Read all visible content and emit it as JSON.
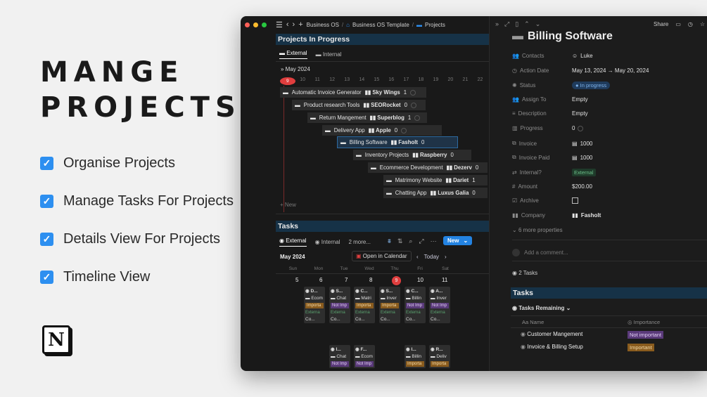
{
  "hero": {
    "line1": "MANGE",
    "line2": "PROJECTS"
  },
  "features": [
    "Organise Projects",
    "Manage Tasks For Projects",
    "Details View For Projects",
    "Timeline View"
  ],
  "logo": "N",
  "topbar": {
    "crumb1": "Business OS",
    "crumb2": "Business OS Template",
    "crumb3": "Projects",
    "share": "Share"
  },
  "projects": {
    "title": "Projects In Progress",
    "tabs": [
      "External",
      "Internal"
    ],
    "month": "May 2024",
    "days": [
      "9",
      "10",
      "11",
      "12",
      "13",
      "14",
      "15",
      "16",
      "17",
      "18",
      "19",
      "20",
      "21",
      "22"
    ],
    "rows": [
      {
        "name": "Automatic Invoice Generator",
        "company": "Sky Wings",
        "count": "1"
      },
      {
        "name": "Product research Tools",
        "company": "SEORocket",
        "count": "0"
      },
      {
        "name": "Return Mangement",
        "company": "Superblog",
        "count": "1"
      },
      {
        "name": "Delivery App",
        "company": "Apple",
        "count": "0"
      },
      {
        "name": "Billing Software",
        "company": "Fasholt",
        "count": "0"
      },
      {
        "name": "Inventory Projects",
        "company": "Raspberry",
        "count": "0"
      },
      {
        "name": "Ecommerce Development",
        "company": "Dezerv",
        "count": "0"
      },
      {
        "name": "Matrimony Website",
        "company": "Dariet",
        "count": "1"
      },
      {
        "name": "Chatting App",
        "company": "Luxus Galia",
        "count": "0"
      }
    ],
    "new_label": "New"
  },
  "tasks": {
    "title": "Tasks",
    "tabs": [
      "External",
      "Internal",
      "2 more..."
    ],
    "new_button": "New",
    "month": "May 2024",
    "open_calendar": "Open in Calendar",
    "today": "Today",
    "weekdays": [
      "Sun",
      "Mon",
      "Tue",
      "Wed",
      "Thu",
      "Fri",
      "Sat"
    ],
    "dates": [
      "5",
      "6",
      "7",
      "8",
      "9",
      "10",
      "11"
    ],
    "cards": [
      {
        "t": "D...",
        "p": "Ecom",
        "i": "Importa",
        "e": "Externa",
        "c": "Co..."
      },
      {
        "t": "S...",
        "p": "Chat",
        "i": "Not Imp",
        "e": "Externa",
        "c": "Co..."
      },
      {
        "t": "C...",
        "p": "Matri",
        "i": "Importa",
        "e": "Externa",
        "c": "Co..."
      },
      {
        "t": "S...",
        "p": "Inver",
        "i": "Importa",
        "e": "Externa",
        "c": "Co..."
      },
      {
        "t": "C...",
        "p": "Billin",
        "i": "Not Imp",
        "e": "Externa",
        "c": "Co..."
      },
      {
        "t": "A...",
        "p": "Inver",
        "i": "Not Imp",
        "e": "Externa",
        "c": "Co..."
      }
    ],
    "cards2": [
      {
        "t": "I...",
        "p": "Chat",
        "i": "Not Imp"
      },
      {
        "t": "F...",
        "p": "Ecom",
        "i": "Not Imp"
      },
      {
        "t": "I...",
        "p": "Billin",
        "i": "Importa"
      },
      {
        "t": "R...",
        "p": "Deliv",
        "i": "Importa"
      }
    ]
  },
  "detail": {
    "title": "Billing Software",
    "props": [
      {
        "k": "Contacts",
        "v": "Luke"
      },
      {
        "k": "Action Date",
        "v": "May 13, 2024 → May 20, 2024"
      },
      {
        "k": "Status",
        "v": "In progress"
      },
      {
        "k": "Assign To",
        "v": "Empty"
      },
      {
        "k": "Description",
        "v": "Empty"
      },
      {
        "k": "Progress",
        "v": "0"
      },
      {
        "k": "Invoice",
        "v": "1000"
      },
      {
        "k": "Invoice Paid",
        "v": "1000"
      },
      {
        "k": "Internal?",
        "v": "External"
      },
      {
        "k": "Amount",
        "v": "$200.00"
      },
      {
        "k": "Archive",
        "v": ""
      },
      {
        "k": "Company",
        "v": "Fasholt"
      }
    ],
    "more": "6 more properties",
    "comment": "Add a comment...",
    "tasks_count": "2 Tasks",
    "tasks_title": "Tasks",
    "tasks_remaining": "Tasks Remaining",
    "col_name": "Name",
    "col_importance": "Importance",
    "task_rows": [
      {
        "name": "Customer Mangement",
        "imp": "Not important"
      },
      {
        "name": "Invoice & Billing Setup",
        "imp": "Important"
      }
    ]
  }
}
